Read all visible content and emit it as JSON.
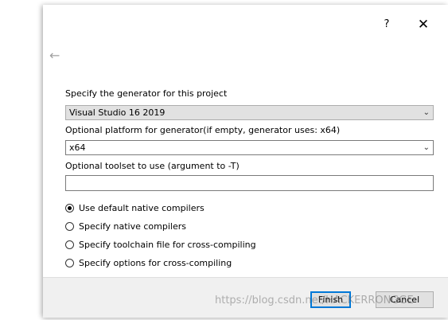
{
  "titlebar": {
    "help_label": "?",
    "close_label": "✕"
  },
  "back_icon": "←",
  "generator": {
    "label": "Specify the generator for this project",
    "value": "Visual Studio 16 2019"
  },
  "platform": {
    "label": "Optional platform for generator(if empty, generator uses: x64)",
    "value": "x64"
  },
  "toolset": {
    "label": "Optional toolset to use (argument to -T)",
    "value": ""
  },
  "compiler_options": [
    {
      "label": "Use default native compilers",
      "checked": true
    },
    {
      "label": "Specify native compilers",
      "checked": false
    },
    {
      "label": "Specify toolchain file for cross-compiling",
      "checked": false
    },
    {
      "label": "Specify options for cross-compiling",
      "checked": false
    }
  ],
  "buttons": {
    "finish": "Finish",
    "cancel": "Cancel"
  },
  "watermark": "https://blog.csdn.net/HACKERRONGGE",
  "colors": {
    "accent": "#0078d7",
    "button_face": "#e1e1e1",
    "footer_bg": "#f0f0f0"
  }
}
